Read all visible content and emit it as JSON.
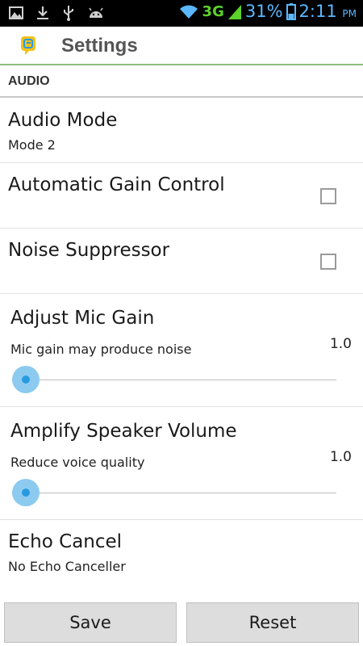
{
  "status_bar": {
    "network": "3G",
    "battery": "31%",
    "time": "2:11",
    "ampm": "PM",
    "icons": [
      "image-icon",
      "download-icon",
      "usb-icon",
      "android-icon",
      "wifi-icon",
      "signal-icon",
      "battery-icon"
    ]
  },
  "app_bar": {
    "title": "Settings"
  },
  "section": {
    "title": "AUDIO"
  },
  "settings": {
    "audio_mode": {
      "title": "Audio Mode",
      "summary": "Mode 2"
    },
    "agc": {
      "title": "Automatic Gain Control",
      "checked": false
    },
    "noise": {
      "title": "Noise Suppressor",
      "checked": false
    },
    "mic_gain": {
      "title": "Adjust Mic Gain",
      "summary": "Mic gain may produce noise",
      "value": "1.0"
    },
    "speaker": {
      "title": "Amplify Speaker Volume",
      "summary": "Reduce voice quality",
      "value": "1.0"
    },
    "echo": {
      "title": "Echo Cancel",
      "summary": "No Echo Canceller"
    }
  },
  "buttons": {
    "save": "Save",
    "reset": "Reset"
  },
  "colors": {
    "accent": "#2a9ae0",
    "divider": "#8bbf7f",
    "button_bg": "#dddddd"
  }
}
